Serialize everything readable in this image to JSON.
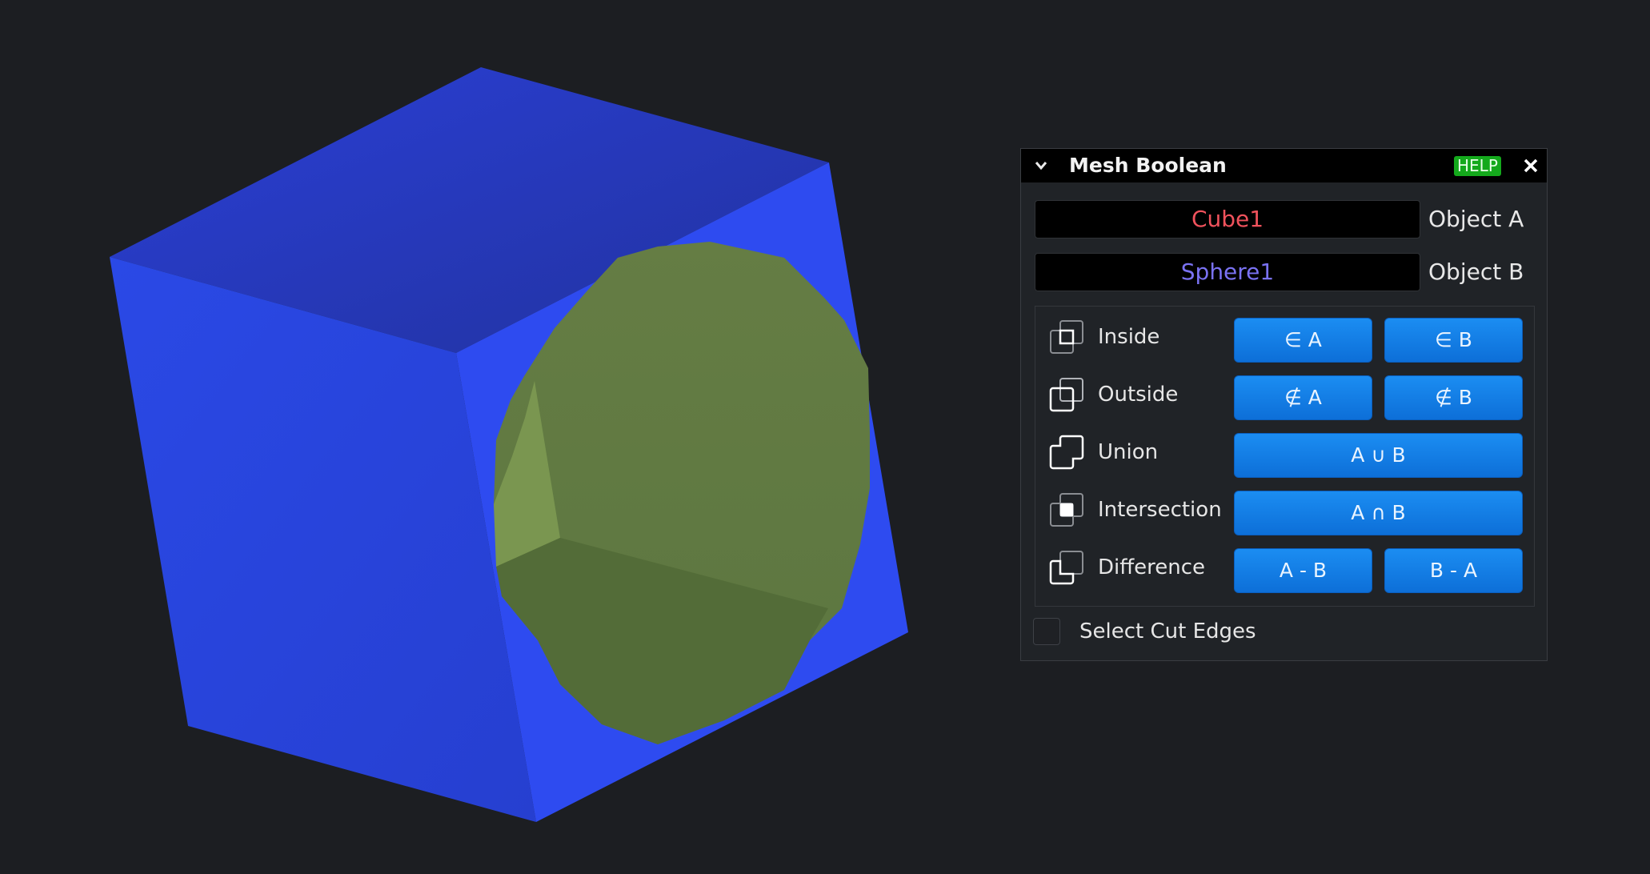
{
  "viewport": {
    "background": "#1c1e22",
    "cube_color": "#2f4ef2",
    "sphere_color": "#637a42"
  },
  "panel": {
    "title": "Mesh Boolean",
    "help_label": "HELP",
    "object_a": {
      "value": "Cube1",
      "label": "Object A",
      "color": "#f0525c"
    },
    "object_b": {
      "value": "Sphere1",
      "label": "Object B",
      "color": "#7a72f2"
    },
    "operations": [
      {
        "label": "Inside",
        "buttons": [
          "∈ A",
          "∈ B"
        ]
      },
      {
        "label": "Outside",
        "buttons": [
          "∉ A",
          "∉ B"
        ]
      },
      {
        "label": "Union",
        "buttons": [
          "A ∪ B"
        ]
      },
      {
        "label": "Intersection",
        "buttons": [
          "A ∩ B"
        ]
      },
      {
        "label": "Difference",
        "buttons": [
          "A - B",
          "B - A"
        ]
      }
    ],
    "select_cut_edges": {
      "label": "Select Cut Edges",
      "checked": false
    },
    "button_color": "#137ee8",
    "help_color": "#14a91c"
  }
}
